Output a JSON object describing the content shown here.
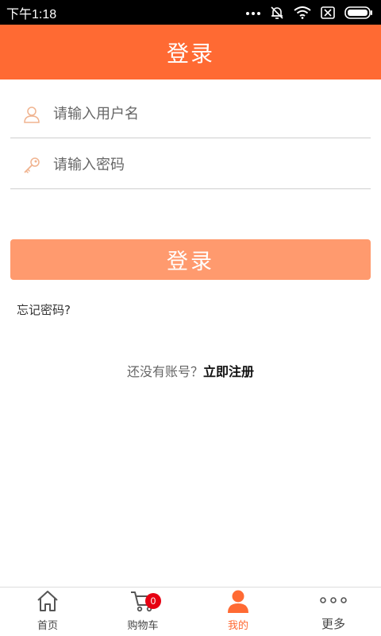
{
  "status_bar": {
    "time": "下午1:18",
    "icons": [
      "more-dots-icon",
      "bell-muted-icon",
      "wifi-icon",
      "no-sim-icon",
      "battery-icon"
    ]
  },
  "header": {
    "title": "登录"
  },
  "form": {
    "username_placeholder": "请输入用户名",
    "username_icon": "user-icon",
    "password_placeholder": "请输入密码",
    "password_icon": "key-icon",
    "login_label": "登录",
    "forgot_label": "忘记密码?"
  },
  "register": {
    "prompt": "还没有账号？",
    "link_label": "立即注册"
  },
  "bottom_nav": {
    "items": [
      {
        "label": "首页",
        "icon": "home-icon"
      },
      {
        "label": "购物车",
        "icon": "cart-icon",
        "badge": "0"
      },
      {
        "label": "我的",
        "icon": "profile-icon",
        "active": true
      },
      {
        "label": "更多",
        "icon": "more-dots-icon"
      }
    ]
  },
  "colors": {
    "primary": "#ff6a33",
    "button": "#ff9a6e",
    "badge": "#e60012"
  }
}
